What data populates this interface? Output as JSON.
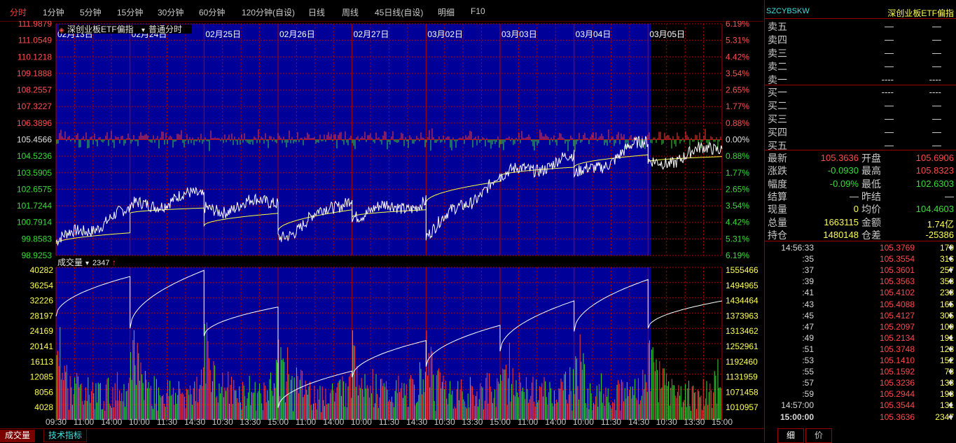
{
  "toolbar": {
    "tabs": [
      {
        "label": "分时",
        "active": true
      },
      {
        "label": "1分钟"
      },
      {
        "label": "5分钟"
      },
      {
        "label": "15分钟"
      },
      {
        "label": "30分钟"
      },
      {
        "label": "60分钟"
      },
      {
        "label": "120分钟(自设)"
      },
      {
        "label": "日线"
      },
      {
        "label": "周线"
      },
      {
        "label": "45日线(自设)"
      },
      {
        "label": "明细"
      },
      {
        "label": "F10"
      }
    ]
  },
  "price_panel": {
    "instrument_title": "深创业板ETF偏指",
    "mode_label": "普通分时",
    "y_labels_left": [
      "111.9879",
      "111.0549",
      "110.1218",
      "109.1888",
      "108.2557",
      "107.3227",
      "106.3896",
      "105.4566",
      "104.5236",
      "103.5905",
      "102.6575",
      "101.7244",
      "100.7914",
      "99.8583",
      "98.9253"
    ],
    "y_labels_right": [
      "6.19%",
      "5.31%",
      "4.42%",
      "3.54%",
      "2.65%",
      "1.77%",
      "0.88%",
      "0.00%",
      "0.88%",
      "1.77%",
      "2.65%",
      "3.54%",
      "4.42%",
      "5.31%",
      "6.19%"
    ],
    "dates": [
      "02月13日",
      "02月24日",
      "02月25日",
      "02月26日",
      "02月27日",
      "03月02日",
      "03月03日",
      "03月04日",
      "03月05日"
    ]
  },
  "volume_panel": {
    "title": "成交量",
    "current_value": "2347",
    "y_labels_left": [
      "40282",
      "36254",
      "32226",
      "28197",
      "24169",
      "20141",
      "16113",
      "12085",
      "8056",
      "4028"
    ],
    "y_labels_right": [
      "1555466",
      "1494965",
      "1434464",
      "1373963",
      "1313462",
      "1252961",
      "1192460",
      "1131959",
      "1071458",
      "1010957"
    ]
  },
  "time_axis": [
    "09:30",
    "11:00",
    "14:00",
    "10:00",
    "11:30",
    "14:30",
    "10:30",
    "13:30",
    "15:00",
    "11:00",
    "14:00",
    "10:00",
    "11:30",
    "14:30",
    "10:30",
    "13:30",
    "15:00",
    "11:00",
    "14:00",
    "10:00",
    "11:30",
    "14:30",
    "10:30",
    "13:30",
    "15:00"
  ],
  "bottom_tabs": [
    "成交量",
    "技术指标"
  ],
  "colors": {
    "up": "#ff3a3a",
    "down": "#3adc3a",
    "grid": "#b00000",
    "panel_bg": "#000098",
    "price_line": "#ffffff",
    "avg_line": "#ffff40"
  },
  "chart_data": {
    "type": "line",
    "series": [
      {
        "name": "深创业板ETF偏指",
        "last": 105.3636,
        "open": 105.6906,
        "high": 105.8323,
        "low": 102.6303
      }
    ],
    "ylim": [
      98.9253,
      111.9879
    ],
    "prev_close": 105.4566
  },
  "right_panel": {
    "symbol": "SZCYBSKW",
    "name": "深创业板ETF偏指",
    "asks": [
      {
        "label": "卖五",
        "price": "—",
        "vol": "—"
      },
      {
        "label": "卖四",
        "price": "—",
        "vol": "—"
      },
      {
        "label": "卖三",
        "price": "—",
        "vol": "—"
      },
      {
        "label": "卖二",
        "price": "—",
        "vol": "—"
      },
      {
        "label": "卖一",
        "price": "----",
        "vol": "----"
      }
    ],
    "bids": [
      {
        "label": "买一",
        "price": "----",
        "vol": "----"
      },
      {
        "label": "买二",
        "price": "—",
        "vol": "—"
      },
      {
        "label": "买三",
        "price": "—",
        "vol": "—"
      },
      {
        "label": "买四",
        "price": "—",
        "vol": "—"
      },
      {
        "label": "买五",
        "price": "—",
        "vol": "—"
      }
    ],
    "quote": [
      {
        "l1": "最新",
        "v1": "105.3636",
        "c1": "#ff4a4a",
        "l2": "开盘",
        "v2": "105.6906",
        "c2": "#ff4a4a"
      },
      {
        "l1": "涨跌",
        "v1": "-0.0930",
        "c1": "#3adc3a",
        "l2": "最高",
        "v2": "105.8323",
        "c2": "#ff4a4a"
      },
      {
        "l1": "幅度",
        "v1": "-0.09%",
        "c1": "#3adc3a",
        "l2": "最低",
        "v2": "102.6303",
        "c2": "#3adc3a"
      },
      {
        "l1": "结算",
        "v1": "—",
        "c1": "#e0e0e0",
        "l2": "昨结",
        "v2": "—",
        "c2": "#e0e0e0"
      },
      {
        "l1": "现量",
        "v1": "0",
        "c1": "#ffff55",
        "l2": "均价",
        "v2": "104.4603",
        "c2": "#3adc3a"
      },
      {
        "l1": "总量",
        "v1": "1663115",
        "c1": "#ffff55",
        "l2": "金额",
        "v2": "1.74亿",
        "c2": "#ffff55"
      },
      {
        "l1": "持仓",
        "v1": "1480148",
        "c1": "#ffff55",
        "l2": "仓差",
        "v2": "-25386",
        "c2": "#ffff55"
      }
    ],
    "ticks": [
      {
        "time": "14:56:33",
        "price": "105.3769",
        "vol": "179"
      },
      {
        "time": ":35",
        "price": "105.3554",
        "vol": "316"
      },
      {
        "time": ":37",
        "price": "105.3601",
        "vol": "257"
      },
      {
        "time": ":39",
        "price": "105.3563",
        "vol": "358"
      },
      {
        "time": ":41",
        "price": "105.4102",
        "vol": "238"
      },
      {
        "time": ":43",
        "price": "105.4088",
        "vol": "165"
      },
      {
        "time": ":45",
        "price": "105.4127",
        "vol": "305"
      },
      {
        "time": ":47",
        "price": "105.2097",
        "vol": "109"
      },
      {
        "time": ":49",
        "price": "105.2134",
        "vol": "191"
      },
      {
        "time": ":51",
        "price": "105.3748",
        "vol": "128"
      },
      {
        "time": ":53",
        "price": "105.1410",
        "vol": "152"
      },
      {
        "time": ":55",
        "price": "105.1592",
        "vol": "78"
      },
      {
        "time": ":57",
        "price": "105.3236",
        "vol": "133"
      },
      {
        "time": ":59",
        "price": "105.2944",
        "vol": "198"
      },
      {
        "time": "14:57:00",
        "price": "105.3544",
        "vol": "131"
      },
      {
        "time": "15:00:00",
        "price": "105.3636",
        "vol": "2347"
      }
    ],
    "tabs": [
      "细",
      "价"
    ]
  }
}
